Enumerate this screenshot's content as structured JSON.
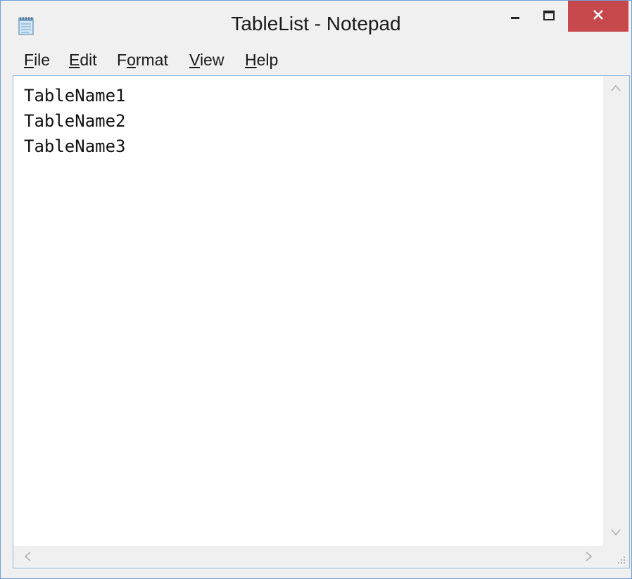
{
  "window": {
    "title": "TableList - Notepad",
    "close_color": "#c7484a"
  },
  "icons": {
    "app": "notepad-icon",
    "minimize": "minimize-icon",
    "maximize": "maximize-icon",
    "close": "close-icon",
    "resize_grip": "resize-grip-icon"
  },
  "menu": {
    "items": [
      {
        "pre": "",
        "acc": "F",
        "post": "ile"
      },
      {
        "pre": "",
        "acc": "E",
        "post": "dit"
      },
      {
        "pre": "F",
        "acc": "o",
        "post": "rmat"
      },
      {
        "pre": "",
        "acc": "V",
        "post": "iew"
      },
      {
        "pre": "",
        "acc": "H",
        "post": "elp"
      }
    ]
  },
  "editor": {
    "lines": [
      "TableName1",
      "TableName2",
      "TableName3"
    ]
  }
}
